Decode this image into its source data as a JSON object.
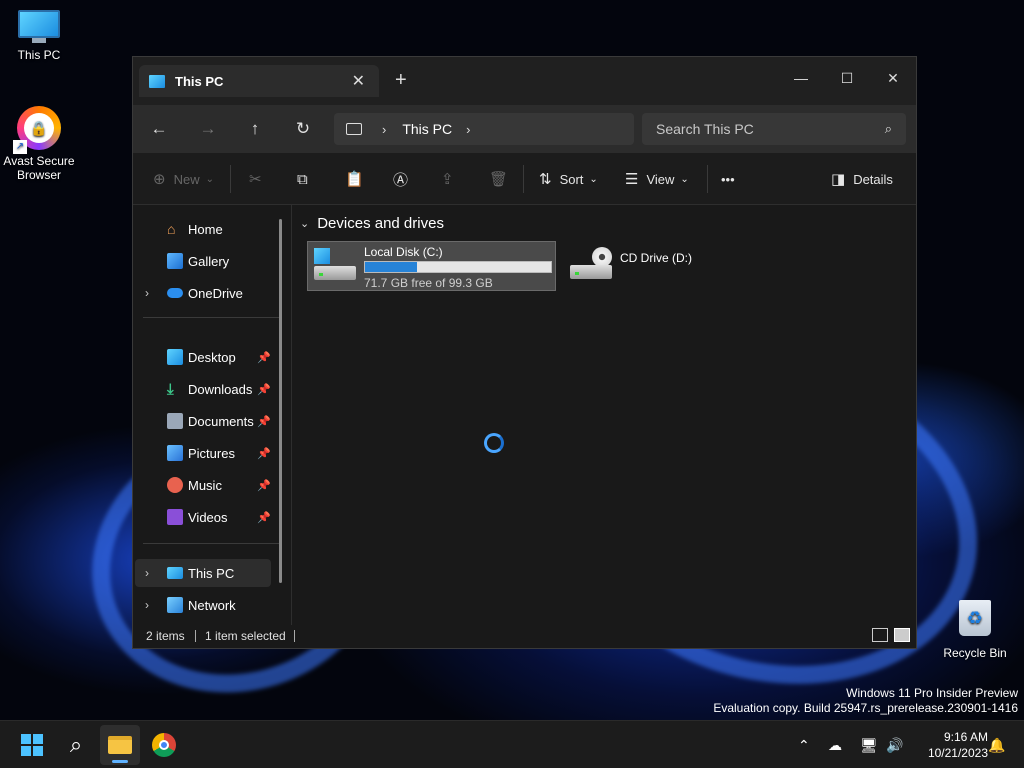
{
  "desktop": {
    "icons": [
      {
        "label": "This PC"
      },
      {
        "label_line1": "Avast Secure",
        "label_line2": "Browser"
      },
      {
        "label": "Recycle Bin"
      }
    ],
    "watermark": {
      "line1": "Windows 11 Pro Insider Preview",
      "line2": "Evaluation copy. Build 25947.rs_prerelease.230901-1416"
    }
  },
  "window": {
    "tab_title": "This PC",
    "tab_close": "✕",
    "new_tab": "+",
    "controls": {
      "minimize": "—",
      "maximize": "☐",
      "close": "✕"
    },
    "nav": {
      "back": "←",
      "forward": "→",
      "up": "↑",
      "refresh": "↻"
    },
    "address": {
      "crumb": "This PC",
      "sep": "›"
    },
    "search": {
      "placeholder": "Search This PC",
      "icon": "⌕"
    },
    "command_bar": {
      "new_label": "New",
      "sort_label": "Sort",
      "view_label": "View",
      "more_label": "•••",
      "details_label": "Details",
      "caret": "⌄"
    },
    "sidebar": {
      "items": [
        {
          "label": "Home"
        },
        {
          "label": "Gallery"
        },
        {
          "label": "OneDrive"
        },
        {
          "label": "Desktop"
        },
        {
          "label": "Downloads"
        },
        {
          "label": "Documents"
        },
        {
          "label": "Pictures"
        },
        {
          "label": "Music"
        },
        {
          "label": "Videos"
        },
        {
          "label": "This PC"
        },
        {
          "label": "Network"
        }
      ],
      "expand_glyph": "›",
      "pin_glyph": "📌"
    },
    "content": {
      "group_title": "Devices and drives",
      "group_chevron": "⌄",
      "drives": [
        {
          "name": "Local Disk (C:)",
          "free_text": "71.7 GB free of 99.3 GB",
          "used_fraction": 0.278
        },
        {
          "name": "CD Drive (D:)"
        }
      ]
    },
    "status": {
      "items_count": "2 items",
      "selected": "1 item selected"
    }
  },
  "taskbar": {
    "tray_chevron": "⌃",
    "clock_time": "9:16 AM",
    "clock_date": "10/21/2023"
  },
  "colors": {
    "accent": "#4cc2ff",
    "progress_fill": "#2683d8",
    "window_bg": "#191919",
    "selection_bg": "#4a4a4a"
  }
}
